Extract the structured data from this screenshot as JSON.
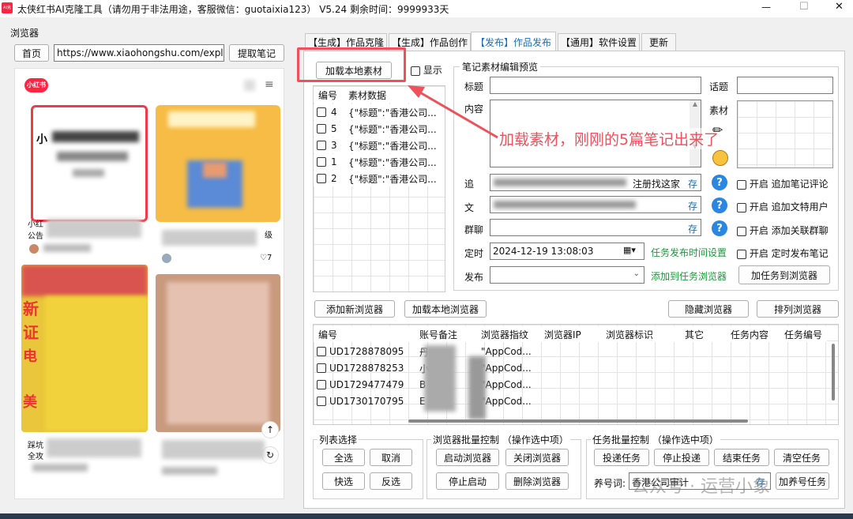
{
  "window": {
    "title": "太侠红书AI克隆工具（请勿用于非法用途，客服微信：guotaixia123） V5.24 剩余时间：9999933天",
    "app_icon_text": "AI克隆",
    "controls": [
      "—",
      "☐",
      "✕"
    ]
  },
  "browser_panel": {
    "group_label": "浏览器",
    "home_button": "首页",
    "url_value": "https://www.xiaohongshu.com/explor",
    "fetch_button": "提取笔记",
    "logo": "小红书",
    "card1_text": "小",
    "card_bottom_left": "小红",
    "card_bottom_left2": "公告",
    "card_right_tag": "级",
    "like_count": "♡7",
    "card3_bottom": "踩坑",
    "card3_bottom2": "全攻",
    "card3_left_chars": [
      "新",
      "证",
      "电",
      "美"
    ],
    "float_icons": [
      "↑",
      "↻"
    ]
  },
  "tabs": [
    {
      "label": "【生成】作品克隆",
      "active": false
    },
    {
      "label": "【生成】作品创作",
      "active": false
    },
    {
      "label": "【发布】作品发布",
      "active": true
    },
    {
      "label": "【通用】软件设置",
      "active": false
    },
    {
      "label": "更新",
      "active": false
    }
  ],
  "material_panel": {
    "load_button": "加载本地素材",
    "show_checkbox": "显示",
    "columns": [
      "编号",
      "素材数据"
    ],
    "rows": [
      {
        "id": "4",
        "data": "{\"标题\":\"香港公司..."
      },
      {
        "id": "5",
        "data": "{\"标题\":\"香港公司..."
      },
      {
        "id": "3",
        "data": "{\"标题\":\"香港公司..."
      },
      {
        "id": "1",
        "data": "{\"标题\":\"香港公司..."
      },
      {
        "id": "2",
        "data": "{\"标题\":\"香港公司..."
      }
    ]
  },
  "annotation": "加载素材，刚刚的5篇笔记出来了",
  "editor": {
    "group_label": "笔记素材编辑预览",
    "title_label": "标题",
    "topic_label": "话题",
    "content_label": "内容",
    "material_label": "素材",
    "follow_label": "追",
    "follow_suffix": "注册找这家",
    "follow_store": "存",
    "text_label": "文",
    "group_chat_label": "群聊",
    "store": "存",
    "timer_label": "定时",
    "datetime_value": "2024-12-19 13:08:03",
    "task_time_link": "任务发布时间设置",
    "publish_label": "发布",
    "add_to_browser_link": "添加到任务浏览器",
    "add_task_button": "加任务到浏览器",
    "opt1_on": "开启",
    "opt1": "追加笔记评论",
    "opt2_on": "开启",
    "opt2": "追加文特用户",
    "opt3_on": "开启",
    "opt3": "添加关联群聊",
    "opt4_on": "开启",
    "opt4": "定时发布笔记"
  },
  "browser_manager": {
    "add_browser": "添加新浏览器",
    "load_local_browser": "加载本地浏览器",
    "hide_browser": "隐藏浏览器",
    "arrange_browser": "排列浏览器",
    "columns": [
      "编号",
      "账号备注",
      "浏览器指纹",
      "浏览器IP",
      "浏览器标识",
      "其它",
      "任务内容",
      "任务编号"
    ],
    "rows": [
      {
        "id": "UD1728878095",
        "note": "丹",
        "fp": "\"AppCod..."
      },
      {
        "id": "UD1728878253",
        "note": "小",
        "fp": "\"AppCod..."
      },
      {
        "id": "UD1729477479",
        "note": "B",
        "fp": "\"AppCod..."
      },
      {
        "id": "UD1730170795",
        "note": "E",
        "fp": "\"AppCod..."
      }
    ]
  },
  "list_select": {
    "label": "列表选择",
    "select_all": "全选",
    "cancel": "取消",
    "quick_select": "快选",
    "invert": "反选"
  },
  "batch_browser": {
    "label": "浏览器批量控制 （操作选中项）",
    "start": "启动浏览器",
    "close": "关闭浏览器",
    "stop_start": "停止启动",
    "delete": "删除浏览器"
  },
  "batch_task": {
    "label": "任务批量控制 （操作选中项）",
    "deliver": "投递任务",
    "stop_deliver": "停止投递",
    "end": "结束任务",
    "clear": "清空任务",
    "nurture_label": "养号词:",
    "nurture_value": "香港公司审计",
    "store": "存",
    "add_nurture": "加养号任务"
  },
  "watermark": "公众号 · 运营小象",
  "colors": {
    "highlight_box": "#f0505a",
    "annotation_text": "#f0505a",
    "link_green": "#1a9b3a",
    "help_blue": "#2a86e0",
    "brand_red": "#ff2442"
  }
}
